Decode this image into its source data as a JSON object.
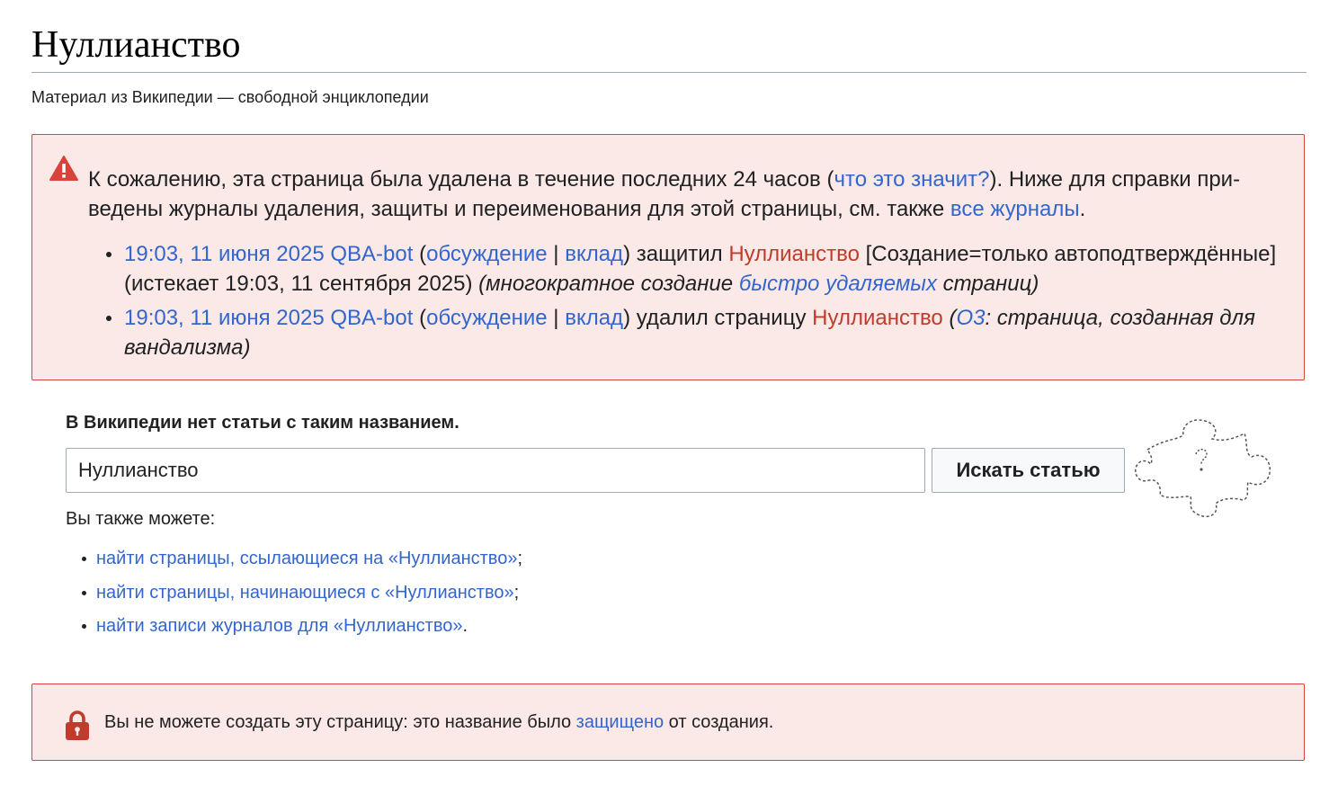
{
  "page": {
    "title": "Нуллианство",
    "tagline": "Материал из Википедии — свободной энциклопедии"
  },
  "warning": {
    "icon": "alert-triangle-icon",
    "intro_1": "К сожалению, эта страница была удалена в течение последних 24 часов (",
    "what_link": "что это значит?",
    "intro_2": "). Ниже для справки при­ведены журналы удаления, защиты и переименования для этой страницы, см. также ",
    "all_logs_link": "все журналы",
    "intro_3": ".",
    "entries": [
      {
        "time": "19:03, 11 июня 2025",
        "user": "QBA-bot",
        "paren_open": " (",
        "talk": "обсуждение",
        "sep": " | ",
        "contribs": "вклад",
        "paren_close": ")",
        "action": " защитил ",
        "page": "Нуллианство",
        "detail": " [Создание=только автоподтверждён­ные] (истекает 19:03, 11 сентября 2025) ",
        "reason_1": "(многократное создание ",
        "reason_link": "быстро удаляемых",
        "reason_2": " страниц)"
      },
      {
        "time": "19:03, 11 июня 2025",
        "user": "QBA-bot",
        "paren_open": " (",
        "talk": "обсуждение",
        "sep": " | ",
        "contribs": "вклад",
        "paren_close": ")",
        "action": " удалил страницу ",
        "page": "Нуллианство",
        "reason_open": " (",
        "reason_link": "О3",
        "reason_text": ": страница, созданная для вандализма)"
      }
    ]
  },
  "missing": {
    "heading": "В Википедии нет статьи с таким названием.",
    "search_value": "Нуллианство",
    "search_button": "Искать статью",
    "also_label": "Вы также можете:",
    "options": [
      {
        "link": "найти страницы, ссылающиеся на «Нуллианство»",
        "end": ";"
      },
      {
        "link": "найти страницы, начинающиеся с «Нуллианство»",
        "end": ";"
      },
      {
        "link": "найти записи журналов для «Нуллианство»",
        "end": "."
      }
    ],
    "illustration": "puzzle-piece-question-icon"
  },
  "protection": {
    "icon": "lock-icon",
    "text_1": "Вы не можете создать эту страницу: это название было ",
    "link": "защищено",
    "text_2": " от создания."
  },
  "colors": {
    "link": "#3366cc",
    "redlink": "#bf3c2c",
    "error_bg": "#fbe9e8",
    "error_border": "#d7443c"
  }
}
